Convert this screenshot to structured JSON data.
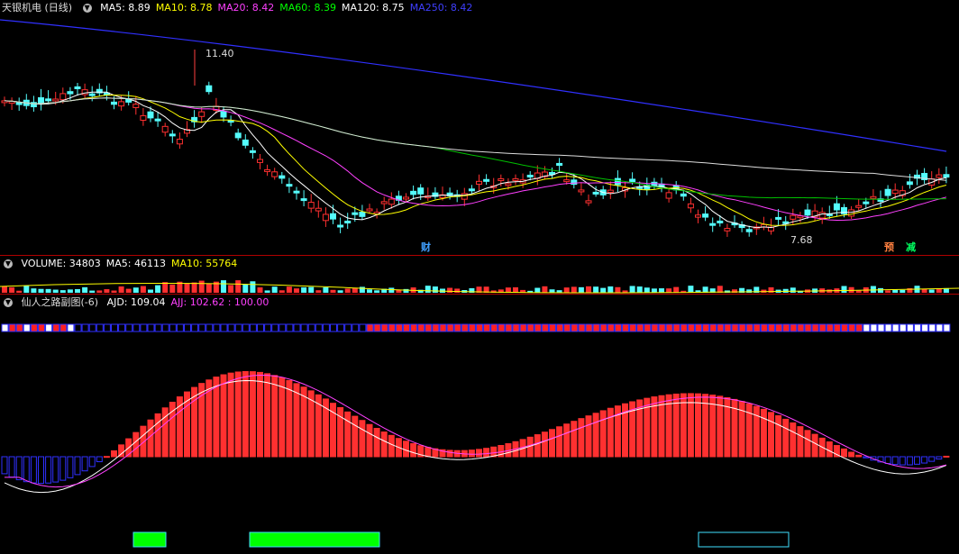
{
  "main": {
    "title": "天银机电 (日线)",
    "indicators": [
      {
        "label": "MA5: 8.89",
        "color": "#ffffff"
      },
      {
        "label": "MA10: 8.78",
        "color": "#ffff00"
      },
      {
        "label": "MA20: 8.42",
        "color": "#ff40ff"
      },
      {
        "label": "MA60: 8.39",
        "color": "#00ff00"
      },
      {
        "label": "MA120: 8.75",
        "color": "#ffffff"
      },
      {
        "label": "MA250: 8.42",
        "color": "#3f3fff"
      }
    ],
    "high_label": "11.40",
    "low_label": "7.68",
    "tags": [
      {
        "text": "财",
        "color": "#40a0ff"
      },
      {
        "text": "预",
        "color": "#ff8040"
      },
      {
        "text": "减",
        "color": "#00ff60"
      }
    ]
  },
  "volume": {
    "indicators": [
      {
        "label": "VOLUME: 34803",
        "color": "#ffffff"
      },
      {
        "label": "MA5: 46113",
        "color": "#ffffff"
      },
      {
        "label": "MA10: 55764",
        "color": "#ffff00"
      }
    ]
  },
  "sub": {
    "name": "仙人之路副图(-6)",
    "indicators": [
      {
        "label": "AJD: 109.04",
        "color": "#ffffff"
      },
      {
        "label": "AJJ: 102.62 : 100.00",
        "color": "#ff40ff"
      }
    ]
  },
  "colors": {
    "up": "#ff3030",
    "down": "#54fcfc",
    "ma250": "#3030ff",
    "bg": "#000000"
  },
  "icons": {
    "collapse": "collapse-icon"
  }
}
